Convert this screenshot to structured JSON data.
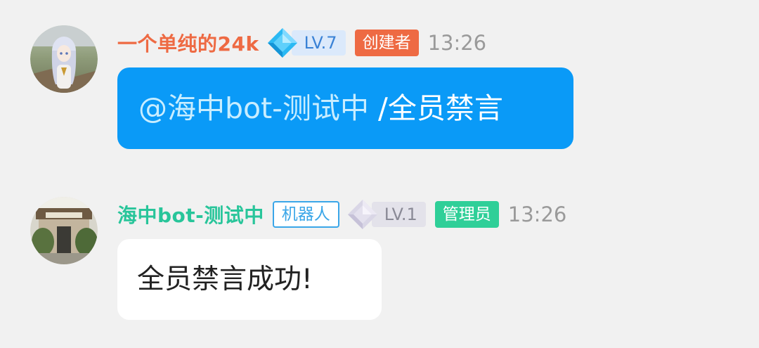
{
  "messages": [
    {
      "sender": "一个单纯的24k",
      "level": "LV.7",
      "role": "创建者",
      "time": "13:26",
      "mention": "@海中bot-测试中",
      "text": " /全员禁言"
    },
    {
      "sender": "海中bot-测试中",
      "tag": "机器人",
      "level": "LV.1",
      "role": "管理员",
      "time": "13:26",
      "text": "全员禁言成功!"
    }
  ],
  "colors": {
    "creator_name": "#ee6a43",
    "creator_badge": "#ee6a43",
    "bot_name": "#28c59a",
    "admin_badge": "#2fcf98",
    "bot_tag": "#3aa6e8",
    "outgoing_bubble": "#0a9af7",
    "mention_text": "#c8edff",
    "timestamp": "#9a9a9a",
    "background": "#f1f1f1"
  },
  "icons": {
    "level_7": "blue-diamond-icon",
    "level_1": "gray-diamond-icon"
  }
}
